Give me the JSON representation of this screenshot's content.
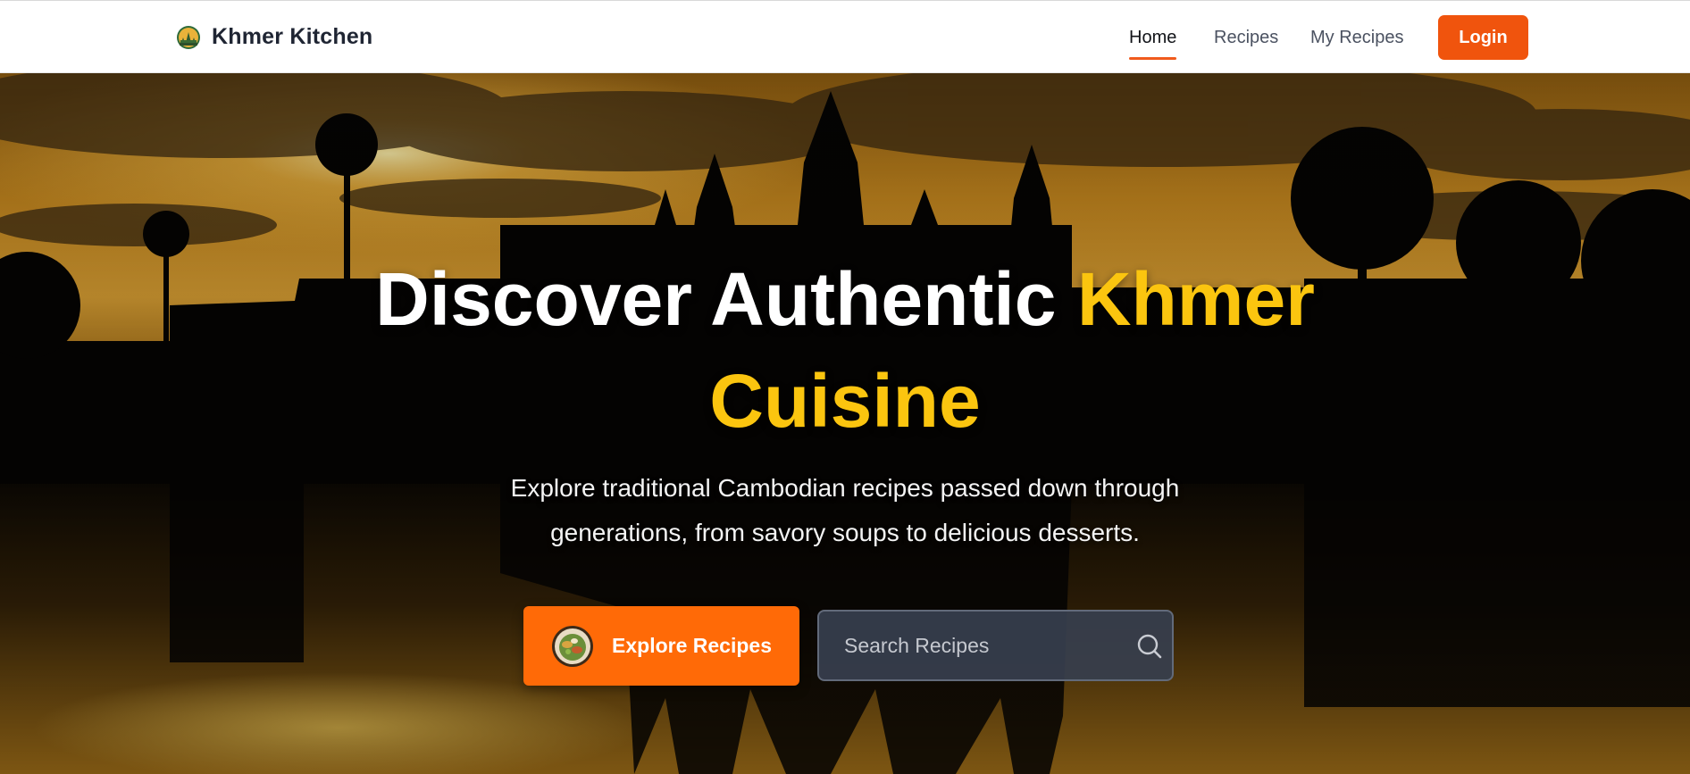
{
  "brand": {
    "name": "Khmer Kitchen",
    "logo_icon": "angkor-temple-logo-icon"
  },
  "nav": {
    "items": [
      {
        "label": "Home",
        "active": true
      },
      {
        "label": "Recipes",
        "active": false
      },
      {
        "label": "My Recipes",
        "active": false
      }
    ],
    "login_label": "Login"
  },
  "hero": {
    "title_part1": "Discover Authentic",
    "title_highlight_1": "Khmer",
    "title_highlight_2": "Cuisine",
    "subtitle": "Explore traditional Cambodian recipes passed down through generations, from savory soups to delicious desserts.",
    "explore_label": "Explore Recipes",
    "explore_icon": "food-bowl-icon",
    "search_placeholder": "Search Recipes",
    "background": "angkor-wat-sunset-image"
  },
  "colors": {
    "accent": "#f0540d",
    "explore_button": "#ff6a07",
    "highlight_text": "#fbc50f",
    "nav_underline": "#f05a1c"
  }
}
